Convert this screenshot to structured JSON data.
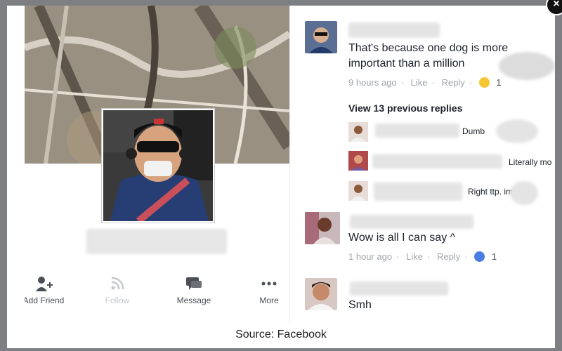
{
  "profile": {
    "actions": [
      {
        "label": "Add Friend",
        "icon": "add-friend-icon"
      },
      {
        "label": "Follow",
        "icon": "rss-icon"
      },
      {
        "label": "Message",
        "icon": "message-icon"
      },
      {
        "label": "More",
        "icon": "more-dots-icon"
      }
    ]
  },
  "comments": {
    "first": {
      "text": "That's because one dog is more important than a million",
      "time": "9 hours ago",
      "like": "Like",
      "reply": "Reply",
      "reaction_count": "1",
      "reaction_icon": "haha-emoji-icon"
    },
    "view_previous": "View 13 previous replies",
    "replies": [
      {
        "text": "Dumb"
      },
      {
        "text": "Literally mo"
      },
      {
        "text": "Right ttp.   im! G"
      }
    ],
    "second": {
      "text": "Wow is all I can say ^",
      "time": "1 hour ago",
      "like": "Like",
      "reply": "Reply",
      "reaction_count": "1",
      "reaction_icon": "like-thumb-icon"
    },
    "third": {
      "text": "Smh"
    }
  },
  "caption": "Source: Facebook",
  "close_label": "×"
}
